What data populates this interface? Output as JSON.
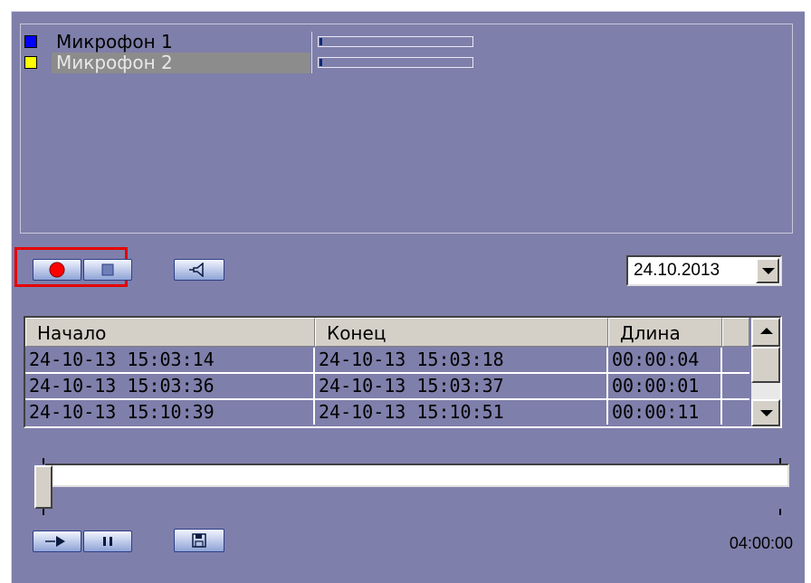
{
  "microphones": [
    {
      "name": "Микрофон 1",
      "color": "#0000ff",
      "level": 0.02,
      "selected": false
    },
    {
      "name": "Микрофон 2",
      "color": "#ffff00",
      "level": 0.02,
      "selected": true
    }
  ],
  "controls": {
    "record_icon": "record-icon",
    "stop_icon": "stop-icon",
    "speaker_icon": "speaker-icon",
    "play_icon": "play-icon",
    "pause_icon": "pause-icon",
    "save_icon": "save-icon"
  },
  "date_picker": {
    "value": "24.10.2013"
  },
  "records": {
    "columns": [
      "Начало",
      "Конец",
      "Длина"
    ],
    "rows": [
      [
        "24-10-13 15:03:14",
        "24-10-13 15:03:18",
        "00:00:04"
      ],
      [
        "24-10-13 15:03:36",
        "24-10-13 15:03:37",
        "00:00:01"
      ],
      [
        "24-10-13 15:10:39",
        "24-10-13 15:10:51",
        "00:00:11"
      ]
    ]
  },
  "timeline": {
    "position": 0.0,
    "time": "04:00:00"
  },
  "colors": {
    "panel": "#7f7fab",
    "highlight": "#e60000",
    "accent": "#2c3f86"
  }
}
